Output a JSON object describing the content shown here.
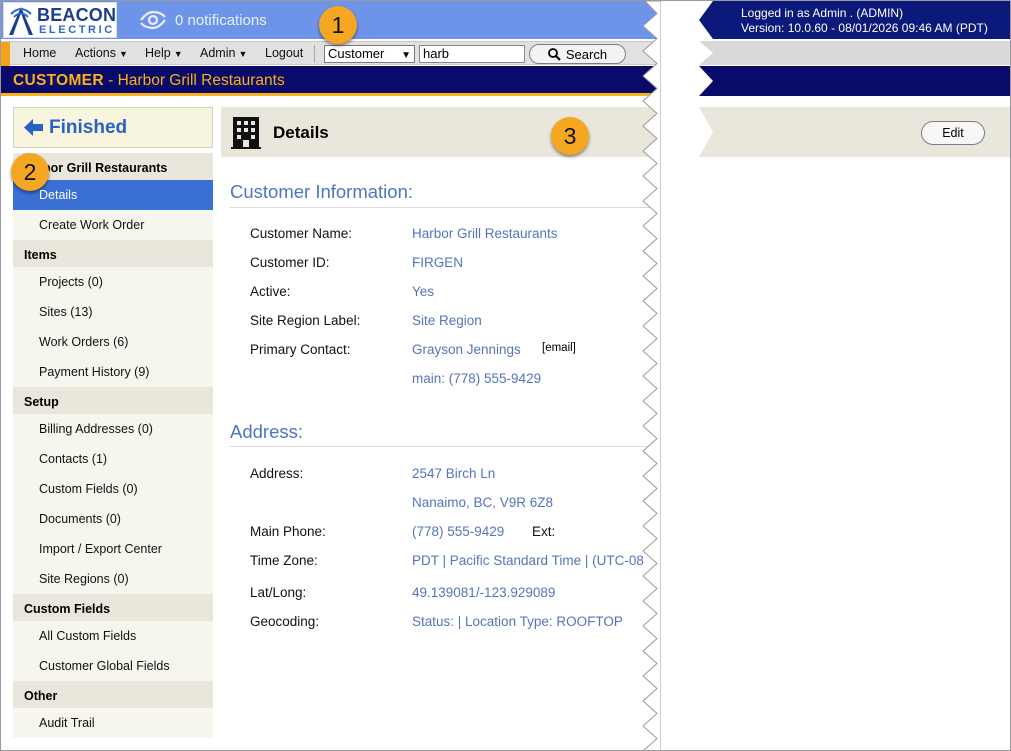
{
  "brand": {
    "line1": "BEACON",
    "line2": "ELECTRIC",
    "logo_icon": "beacon-logo-icon"
  },
  "notifications": {
    "text": "0 notifications",
    "icon": "notification-eye-icon"
  },
  "menu": {
    "home": "Home",
    "actions": "Actions",
    "help": "Help",
    "admin": "Admin",
    "logout": "Logout",
    "caret": "▼",
    "search_type": "Customer",
    "search_value": "harb",
    "search_button": "Search"
  },
  "customer_bar": {
    "prefix": "CUSTOMER",
    "separator": " - ",
    "name": "Harbor Grill Restaurants"
  },
  "session": {
    "logged_in": "Logged in as Admin . (ADMIN)",
    "version": "Version: 10.0.60 - 08/01/2026 09:46 AM (PDT)"
  },
  "sidebar": {
    "finished": "Finished",
    "header_title": "bor Grill Restaurants",
    "top_items": [
      {
        "label": "Details",
        "active": true
      },
      {
        "label": "Create Work Order",
        "active": false
      }
    ],
    "sections": [
      {
        "title": "Items",
        "items": [
          "Projects (0)",
          "Sites (13)",
          "Work Orders (6)",
          "Payment History (9)"
        ]
      },
      {
        "title": "Setup",
        "items": [
          "Billing Addresses (0)",
          "Contacts (1)",
          "Custom Fields (0)",
          "Documents (0)",
          "Import / Export Center",
          "Site Regions (0)"
        ]
      },
      {
        "title": "Custom Fields",
        "items": [
          "All Custom Fields",
          "Customer Global Fields"
        ]
      },
      {
        "title": "Other",
        "items": [
          "Audit Trail"
        ]
      }
    ]
  },
  "details": {
    "header": "Details",
    "edit_button": "Edit",
    "customer_info_title": "Customer Information:",
    "fields": [
      {
        "label": "Customer Name:",
        "value": "Harbor Grill Restaurants"
      },
      {
        "label": "Customer ID:",
        "value": "FIRGEN"
      },
      {
        "label": "Active:",
        "value": "Yes"
      },
      {
        "label": "Site Region Label:",
        "value": "Site Region"
      },
      {
        "label": "Primary Contact:",
        "value": "Grayson Jennings"
      }
    ],
    "email_link": "[email]",
    "contact_phone": "main: (778) 555-9429",
    "address_title": "Address:",
    "address_fields": [
      {
        "label": "Address:",
        "value": "2547 Birch Ln"
      },
      {
        "label": "",
        "value": "Nanaimo, BC, V9R 6Z8"
      },
      {
        "label": "Main Phone:",
        "value": "(778) 555-9429"
      },
      {
        "label": "Time Zone:",
        "value": "PDT | Pacific Standard Time | (UTC-08"
      },
      {
        "label": "Lat/Long:",
        "value": "49.139081/-123.929089"
      },
      {
        "label": "Geocoding:",
        "value": "Status: | Location Type: ROOFTOP"
      }
    ],
    "ext_label": "Ext:"
  },
  "callouts": [
    "1",
    "2",
    "3"
  ],
  "colors": {
    "accent": "#f7a21b",
    "topbar": "#6e94ea",
    "navy": "#0a0a6a",
    "link": "#5574bb",
    "active": "#3a6fd4"
  }
}
